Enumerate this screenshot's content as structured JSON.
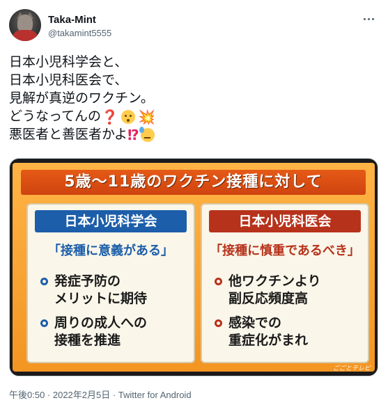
{
  "user": {
    "display_name": "Taka-Mint",
    "handle": "@takamint5555"
  },
  "tweet": {
    "lines": [
      "日本小児科学会と、",
      "日本小児科医会で、",
      "見解が真逆のワクチン。",
      "どうなってんの",
      "悪医者と善医者かよ"
    ],
    "line4_emoji": [
      "red-question-mark",
      "face-with-open-mouth",
      "collision"
    ],
    "line5_emoji": [
      "exclamation-question-mark",
      "downcast-face-with-sweat"
    ],
    "question_glyph": "❓",
    "boom_glyph": "💥",
    "exclaim_question_glyph": "⁉"
  },
  "media": {
    "board_title": "5歳～11歳のワクチン接種に対して",
    "left_panel": {
      "header": "日本小児科学会",
      "tagline": "「接種に意義がある」",
      "bullets": [
        [
          "発症予防の",
          "メリットに期待"
        ],
        [
          "周りの成人への",
          "接種を推進"
        ]
      ]
    },
    "right_panel": {
      "header": "日本小児科医会",
      "tagline": "「接種に慎重であるべき」",
      "bullets": [
        [
          "他ワクチンより",
          "副反応頻度高"
        ],
        [
          "感染での",
          "重症化がまれ"
        ]
      ]
    },
    "watermark": "ごごとテレビ",
    "colors": {
      "board_orange": "#f39522",
      "title_bar": "#e55a16",
      "left_accent": "#1c5ea9",
      "right_accent": "#b7321b"
    }
  },
  "meta": {
    "timestamp_source": "午後0:50 · 2022年2月5日 · Twitter for Android"
  }
}
